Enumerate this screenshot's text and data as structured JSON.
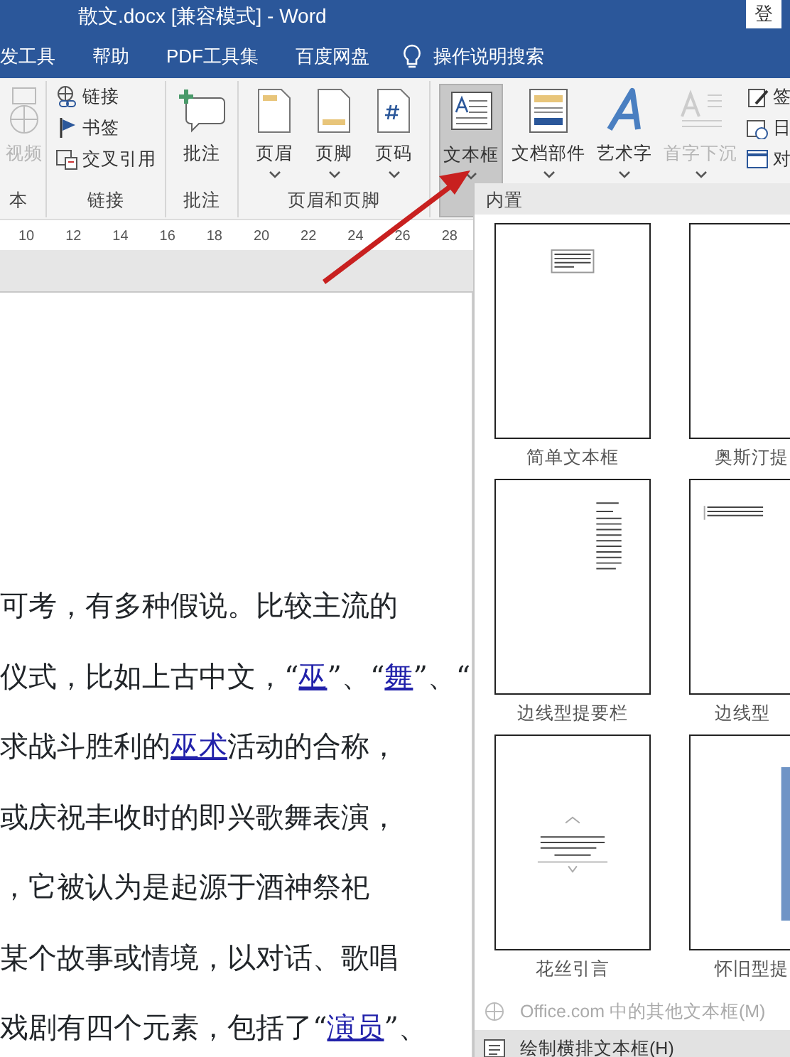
{
  "window": {
    "title": "散文.docx [兼容模式]  -  Word",
    "login_button": "登"
  },
  "menu_tabs": [
    {
      "label": "发工具"
    },
    {
      "label": "帮助"
    },
    {
      "label": "PDF工具集"
    },
    {
      "label": "百度网盘"
    }
  ],
  "search": {
    "label": "操作说明搜索"
  },
  "ribbon_groups": [
    {
      "label": "本",
      "items": [
        {
          "label": "视频",
          "kind": "large",
          "disabled": true
        }
      ]
    },
    {
      "label": "链接",
      "items": [
        {
          "label": "链接",
          "kind": "small",
          "disabled": false
        },
        {
          "label": "书签",
          "kind": "small",
          "disabled": false
        },
        {
          "label": "交叉引用",
          "kind": "small",
          "disabled": false
        }
      ]
    },
    {
      "label": "批注",
      "items": [
        {
          "label": "批注",
          "kind": "large",
          "disabled": false
        }
      ]
    },
    {
      "label": "页眉和页脚",
      "items": [
        {
          "label": "页眉",
          "kind": "dropdown",
          "disabled": false
        },
        {
          "label": "页脚",
          "kind": "dropdown",
          "disabled": false
        },
        {
          "label": "页码",
          "kind": "dropdown",
          "disabled": false
        }
      ]
    },
    {
      "items": [
        {
          "label": "文本框",
          "kind": "dropdown",
          "disabled": false,
          "pressed": true
        },
        {
          "label": "文档部件",
          "kind": "dropdown",
          "disabled": false,
          "pressed": false
        },
        {
          "label": "艺术字",
          "kind": "dropdown",
          "disabled": false,
          "pressed": false
        },
        {
          "label": "首字下沉",
          "kind": "dropdown",
          "disabled": true,
          "pressed": false
        },
        {
          "label": "签",
          "kind": "small",
          "disabled": false,
          "pressed": false
        },
        {
          "label": "日",
          "kind": "small",
          "disabled": false,
          "pressed": false
        },
        {
          "label": "对",
          "kind": "small",
          "disabled": false,
          "pressed": false
        }
      ]
    }
  ],
  "ruler_marks": [
    "10",
    "12",
    "14",
    "16",
    "18",
    "20",
    "22",
    "24",
    "26",
    "28"
  ],
  "document_lines": [
    [
      {
        "text": "可考，有多种假说。比较主流的",
        "link": false
      }
    ],
    [
      {
        "text": "仪式，比如上古中文，“",
        "link": false
      },
      {
        "text": "巫",
        "link": true
      },
      {
        "text": "”、“",
        "link": false
      },
      {
        "text": "舞",
        "link": true
      },
      {
        "text": "”、“",
        "link": false
      }
    ],
    [
      {
        "text": "求战斗胜利的",
        "link": false
      },
      {
        "text": "巫术",
        "link": true
      },
      {
        "text": "活动的合称，",
        "link": false
      }
    ],
    [
      {
        "text": "或庆祝丰收时的即兴歌舞表演，",
        "link": false
      }
    ],
    [
      {
        "text": "，它被认为是起源于酒神祭祀",
        "link": false
      }
    ],
    [
      {
        "text": "某个故事或情境，以对话、歌唱",
        "link": false
      }
    ],
    [
      {
        "text": "戏剧有四个元素，包括了“",
        "link": false
      },
      {
        "text": "演员",
        "link": true
      },
      {
        "text": "”、",
        "link": false
      }
    ]
  ],
  "gallery": {
    "header": "内置",
    "items": [
      {
        "label": "简单文本框",
        "kind": "top-box"
      },
      {
        "label": "奥斯汀提",
        "kind": "edge-line"
      },
      {
        "label": "边线型提要栏",
        "kind": "right-bar"
      },
      {
        "label": "边线型",
        "kind": "top-lines"
      },
      {
        "label": "花丝引言",
        "kind": "ornament"
      },
      {
        "label": "怀旧型提",
        "kind": "blue-bar"
      }
    ],
    "menu": [
      {
        "label": "Office.com 中的其他文本框(M)",
        "disabled": true
      },
      {
        "label": "绘制横排文本框(H)",
        "disabled": false
      }
    ]
  }
}
